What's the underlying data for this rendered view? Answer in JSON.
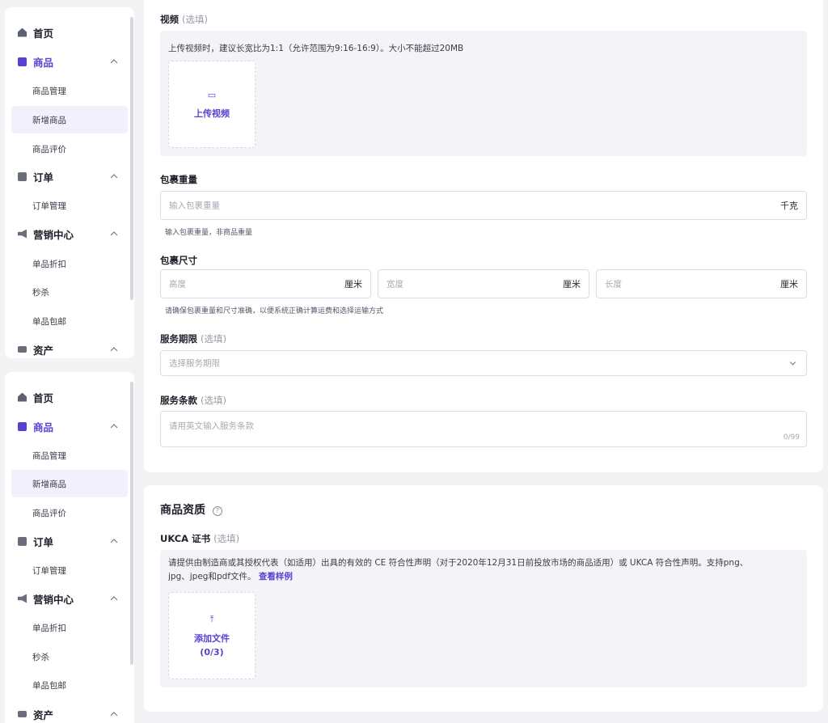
{
  "sidebar": {
    "items": [
      {
        "label": "首页",
        "icon": "home-icon"
      },
      {
        "label": "商品",
        "icon": "bag-icon"
      },
      {
        "label": "商品管理"
      },
      {
        "label": "新增商品"
      },
      {
        "label": "商品评价"
      },
      {
        "label": "订单",
        "icon": "order-icon"
      },
      {
        "label": "订单管理"
      },
      {
        "label": "营销中心",
        "icon": "megaphone-icon"
      },
      {
        "label": "单品折扣"
      },
      {
        "label": "秒杀"
      },
      {
        "label": "单品包邮"
      },
      {
        "label": "资产",
        "icon": "card-icon"
      }
    ]
  },
  "video": {
    "label": "视频",
    "optional": "(选填)",
    "tip": "上传视频时，建议长宽比为1:1（允许范围为9:16-16:9）。大小不能超过20MB",
    "upload_label": "上传视频"
  },
  "weight": {
    "label": "包裹重量",
    "placeholder": "输入包裹重量",
    "unit": "千克",
    "hint": "输入包裹重量，非商品重量"
  },
  "size": {
    "label": "包裹尺寸",
    "fields": [
      {
        "placeholder": "高度",
        "unit": "厘米"
      },
      {
        "placeholder": "宽度",
        "unit": "厘米"
      },
      {
        "placeholder": "长度",
        "unit": "厘米"
      }
    ],
    "hint": "请确保包裹重量和尺寸准确，以便系统正确计算运费和选择运输方式"
  },
  "service_period": {
    "label": "服务期限",
    "optional": "(选填)",
    "placeholder": "选择服务期限"
  },
  "service_terms": {
    "label": "服务条款",
    "optional": "(选填)",
    "placeholder": "请用英文输入服务条款",
    "counter": "0/99"
  },
  "qualification": {
    "title": "商品资质",
    "ukca_label": "UKCA 证书",
    "optional": "(选填)",
    "tip_line1": "请提供由制造商或其授权代表（如适用）出具的有效的 CE 符合性声明（对于2020年12月31日前投放市场的商品适用）或 UKCA 符合性声明。支持png、",
    "tip_line2": "jpg、jpeg和pdf文件。",
    "sample_link": "查看样例",
    "upload_label": "添加文件",
    "upload_count": "(0/3)"
  },
  "colors": {
    "accent": "#5b3fd3",
    "active_bg": "#f2f0fc",
    "panel_bg": "#f4f4f8"
  }
}
